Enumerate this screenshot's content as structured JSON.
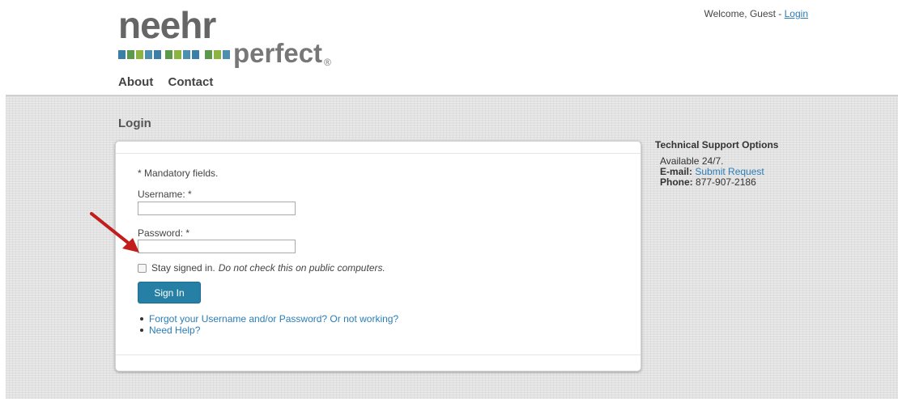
{
  "logo": {
    "main": "neehr",
    "sub": "perfect",
    "reg": "®",
    "square_colors": [
      "#3b7ea6",
      "#5b9a4a",
      "#8cb53f",
      "#4c8fb0"
    ]
  },
  "header": {
    "welcome_text": "Welcome, Guest - ",
    "login_link": "Login"
  },
  "nav": {
    "items": [
      "About",
      "Contact"
    ]
  },
  "page": {
    "title": "Login"
  },
  "form": {
    "mandatory_note": "* Mandatory fields.",
    "username_label": "Username: *",
    "username_value": "",
    "password_label": "Password: *",
    "password_value": "",
    "stay_signed_label": "Stay signed in.",
    "stay_signed_note": "Do not check this on public computers.",
    "stay_signed_checked": false,
    "signin_button": "Sign In",
    "links": [
      "Forgot your Username and/or Password? Or not working?",
      "Need Help?"
    ]
  },
  "support": {
    "title": "Technical Support Options",
    "availability": "Available 24/7.",
    "email_label": "E-mail:",
    "email_link": "Submit Request",
    "phone_label": "Phone:",
    "phone_value": "877-907-2186"
  },
  "colors": {
    "link": "#2a7db7",
    "button": "#2680a5",
    "arrow": "#c21c1c",
    "content_bg": "#e2e2e2"
  },
  "icons": {
    "annotation": "red-arrow-icon"
  }
}
